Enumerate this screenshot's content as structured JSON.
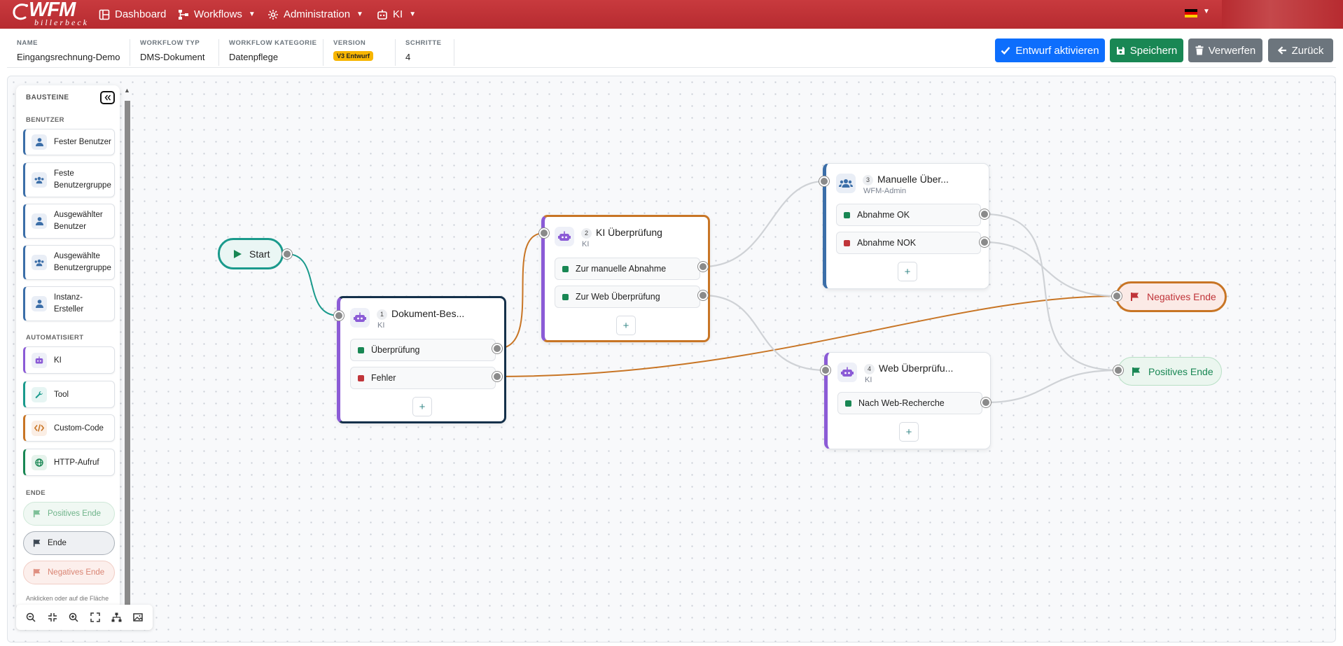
{
  "nav": {
    "logo_text": "WFM",
    "logo_sub": "billerbeck",
    "items": [
      {
        "label": "Dashboard",
        "icon": "dashboard-icon"
      },
      {
        "label": "Workflows",
        "icon": "sitemap-icon"
      },
      {
        "label": "Administration",
        "icon": "gear-icon"
      },
      {
        "label": "KI",
        "icon": "robot-icon"
      }
    ],
    "language_flag": "de-flag-icon"
  },
  "info": {
    "fields": [
      {
        "label": "NAME",
        "value": "Eingangsrechnung-Demo"
      },
      {
        "label": "WORKFLOW TYP",
        "value": "DMS-Dokument"
      },
      {
        "label": "WORKFLOW KATEGORIE",
        "value": "Datenpflege"
      },
      {
        "label": "VERSION",
        "value": "V3 Entwurf"
      },
      {
        "label": "SCHRITTE",
        "value": "4"
      }
    ],
    "buttons": {
      "activate": "Entwurf aktivieren",
      "save": "Speichern",
      "discard": "Verwerfen",
      "back": "Zurück"
    }
  },
  "palette": {
    "title": "BAUSTEINE",
    "sections": {
      "users": "BENUTZER",
      "automated": "AUTOMATISIERT",
      "end": "ENDE"
    },
    "user_items": [
      {
        "line1": "Fester Benutzer",
        "line2": ""
      },
      {
        "line1": "Feste",
        "line2": "Benutzergruppe"
      },
      {
        "line1": "Ausgewählter",
        "line2": "Benutzer"
      },
      {
        "line1": "Ausgewählte",
        "line2": "Benutzergruppe"
      },
      {
        "line1": "Instanz-",
        "line2": "Ersteller"
      }
    ],
    "auto_items": [
      "KI",
      "Tool",
      "Custom-Code",
      "HTTP-Aufruf"
    ],
    "end_items": [
      "Positives Ende",
      "Ende",
      "Negatives Ende"
    ],
    "footer": "Anklicken oder auf die Fläche"
  },
  "canvas": {
    "start": "Start",
    "nodes": [
      {
        "num": "1",
        "title": "Dokument-Bes...",
        "sub": "KI",
        "ports": [
          "Überprüfung",
          "Fehler"
        ]
      },
      {
        "num": "2",
        "title": "KI Überprüfung",
        "sub": "KI",
        "ports": [
          "Zur manuelle Abnahme",
          "Zur Web Überprüfung"
        ]
      },
      {
        "num": "3",
        "title": "Manuelle Über...",
        "sub": "WFM-Admin",
        "ports": [
          "Abnahme OK",
          "Abnahme NOK"
        ]
      },
      {
        "num": "4",
        "title": "Web Überprüfu...",
        "sub": "KI",
        "ports": [
          "Nach Web-Recherche"
        ]
      }
    ],
    "negative_end": "Negatives Ende",
    "positive_end": "Positives Ende",
    "add_label": "+"
  },
  "colors": {
    "brand_red": "#c0353a",
    "primary": "#0d6efd",
    "success": "#198754",
    "secondary": "#6c757d",
    "teal": "#1a9a8c",
    "orange": "#c87525",
    "navy": "#14304a",
    "purple": "#8b5bd6"
  }
}
